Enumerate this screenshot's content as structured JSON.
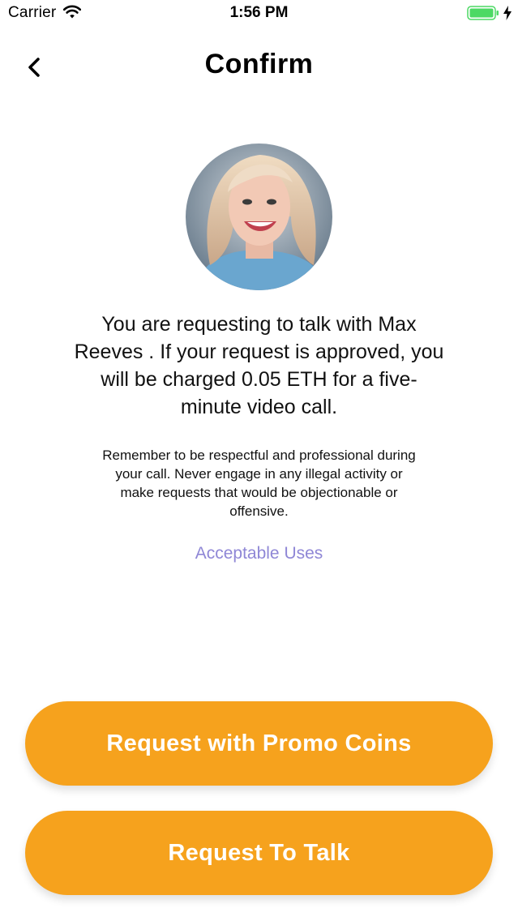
{
  "status_bar": {
    "carrier": "Carrier",
    "time": "1:56 PM",
    "icons": [
      "wifi-icon",
      "battery-icon",
      "charging-icon"
    ]
  },
  "nav": {
    "title": "Confirm",
    "back_icon": "chevron-left-icon"
  },
  "content": {
    "message": "You are requesting to talk with Max Reeves . If your request is approved, you will be charged 0.05 ETH for a five-minute video call.",
    "note": "Remember to be respectful and professional during your call. Never engage in any illegal activity or make requests that would be objectionable or offensive.",
    "link_label": "Acceptable Uses"
  },
  "buttons": {
    "promo_label": "Request with Promo Coins",
    "talk_label": "Request To Talk"
  },
  "colors": {
    "accent": "#f6a21d",
    "link": "#8f87d6",
    "battery": "#4cd964"
  }
}
